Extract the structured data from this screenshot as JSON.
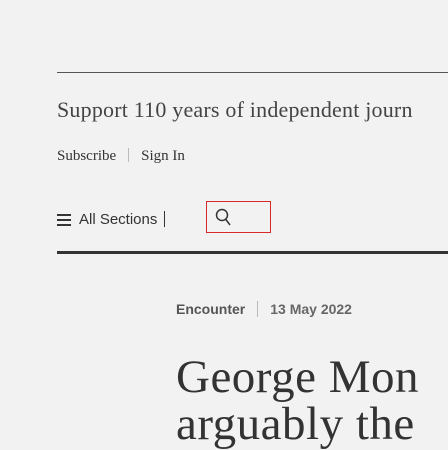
{
  "header": {
    "tagline": "Support 110 years of independent journ",
    "subscribe_label": "Subscribe",
    "signin_label": "Sign In"
  },
  "nav": {
    "sections_label": "All Sections",
    "search_icon": "search-icon",
    "menu_icon": "hamburger-menu-icon"
  },
  "article": {
    "section": "Encounter",
    "date": "13 May 2022",
    "headline_line1": "George Mon",
    "headline_line2": "arguably the"
  },
  "colors": {
    "background": "#f2f2f2",
    "search_border": "#d42a2a",
    "text": "#333333"
  }
}
